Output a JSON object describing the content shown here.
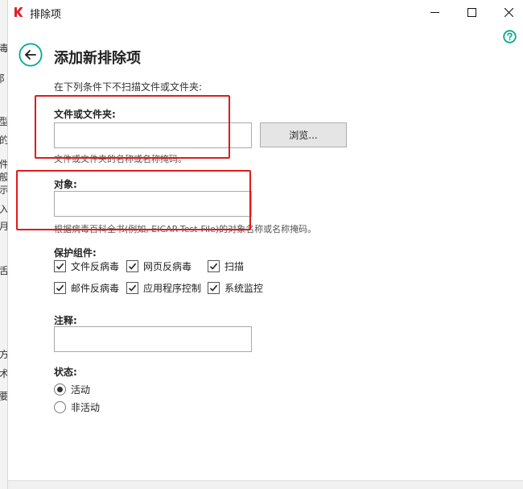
{
  "background_app": {
    "glyphs": [
      {
        "char": "毒"
      },
      {
        "char": "阝"
      },
      {
        "char": "型"
      },
      {
        "char": "的"
      },
      {
        "char": "件"
      },
      {
        "char": "般"
      },
      {
        "char": "示"
      },
      {
        "char": "入"
      },
      {
        "char": "月"
      },
      {
        "char": "舌"
      },
      {
        "char": "方"
      },
      {
        "char": "术"
      },
      {
        "char": "要"
      }
    ]
  },
  "window": {
    "title": "排除项",
    "app_icon": "kaspersky-logo-icon",
    "controls": [
      "minimize-icon",
      "maximize-icon",
      "close-icon"
    ],
    "accent_color": "#00a88e"
  },
  "header": {
    "title": "添加新排除项",
    "subtitle": "在下列条件下不扫描文件或文件夹:"
  },
  "file_field": {
    "label": "文件或文件夹:",
    "value": "",
    "hint": "文件或文件夹的名称或名称掩码。",
    "browse_label": "浏览..."
  },
  "object_field": {
    "label": "对象:",
    "value": "",
    "hint": "根据病毒百科全书(例如, EICAR-Test-File)的对象名称或名称掩码。"
  },
  "components": {
    "label": "保护组件:",
    "items": [
      {
        "label": "文件反病毒",
        "checked": true
      },
      {
        "label": "网页反病毒",
        "checked": true
      },
      {
        "label": "扫描",
        "checked": true
      },
      {
        "label": "邮件反病毒",
        "checked": true
      },
      {
        "label": "应用程序控制",
        "checked": true
      },
      {
        "label": "系统监控",
        "checked": true
      }
    ]
  },
  "comment": {
    "label": "注释:",
    "value": ""
  },
  "status": {
    "label": "状态:",
    "options": [
      {
        "label": "活动",
        "selected": true
      },
      {
        "label": "非活动",
        "selected": false
      }
    ]
  },
  "annotation_color": "#e01a1a"
}
